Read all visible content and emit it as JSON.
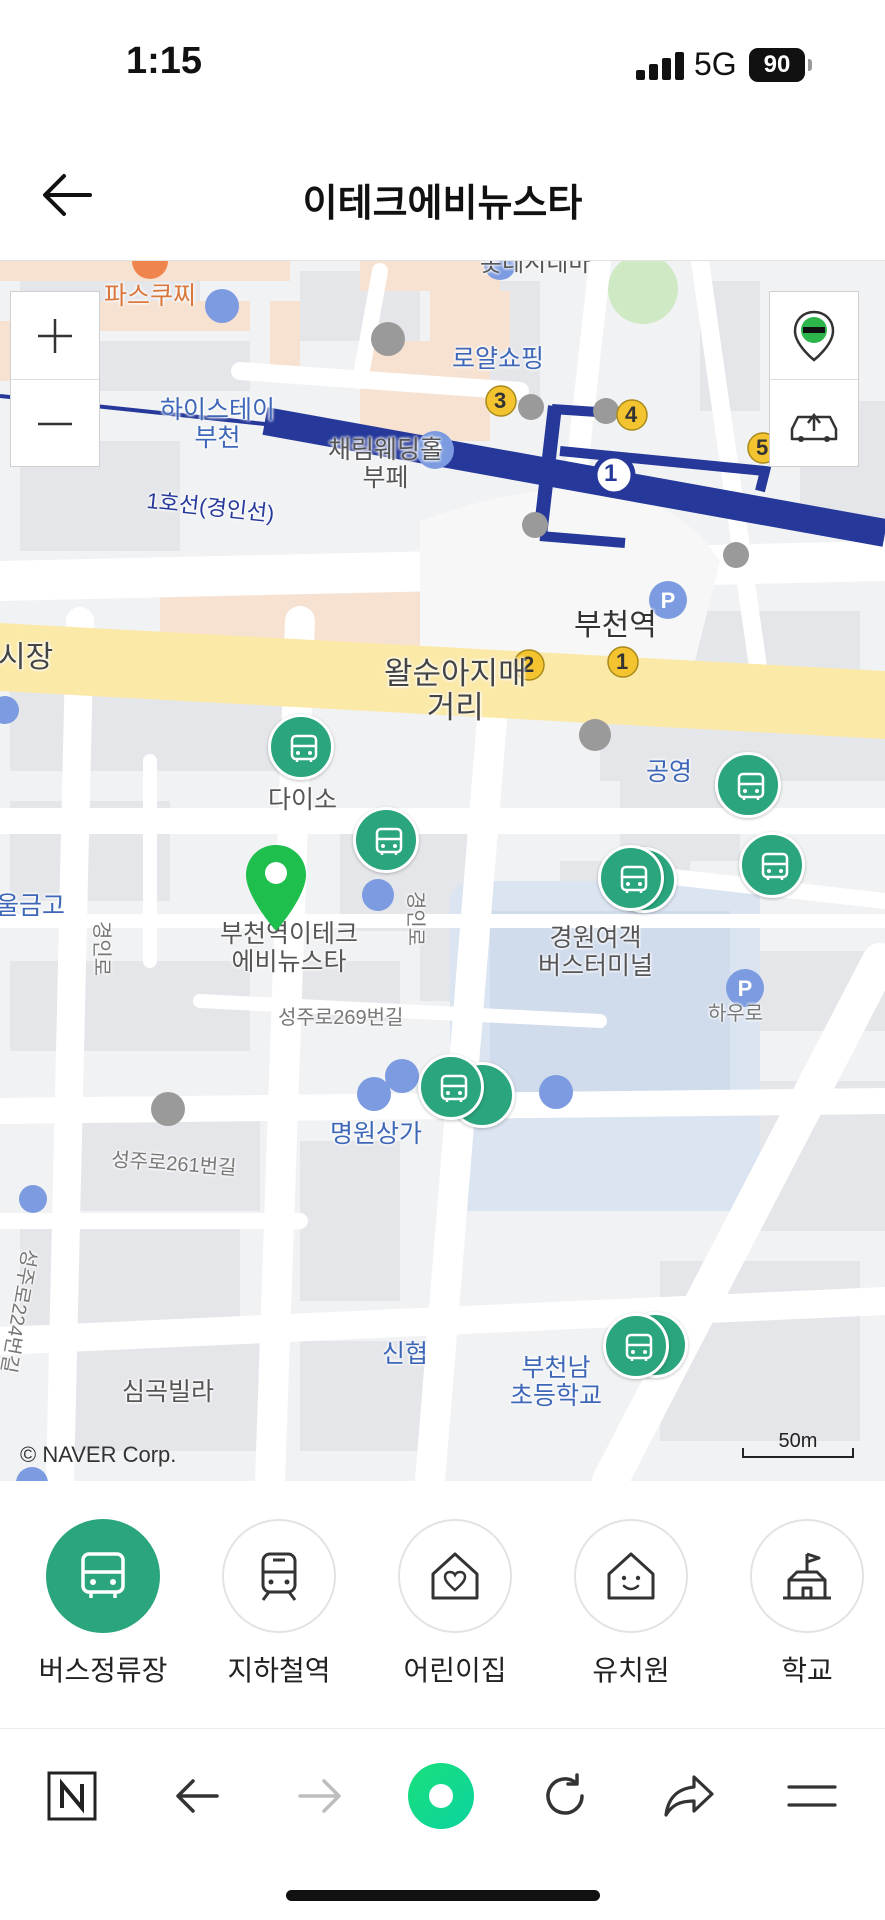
{
  "status_bar": {
    "time": "1:15",
    "network": "5G",
    "battery": "90"
  },
  "header": {
    "title": "이테크에비뉴스타"
  },
  "map": {
    "labels": {
      "pasukuchi": "파스쿠찌",
      "top_partial": "롯데시네마",
      "royal_shopping": "로얄쇼핑",
      "hi_stay_1": "하이스테이",
      "hi_stay_2": "부천",
      "chaerim_1": "채림웨딩홀",
      "chaerim_2": "부페",
      "line1": "1호선(경인선)",
      "bucheon_station": "부천역",
      "market": "시장",
      "walsun_1": "왈순아지매",
      "walsun_2": "거리",
      "daiso": "다이소",
      "public_parking": "공영",
      "geumgo": "울금고",
      "place_name_1": "부천역이테크",
      "place_name_2": "에비뉴스타",
      "gyeongwon_1": "경원여객",
      "gyeongwon_2": "버스터미널",
      "gyeongin_ro_1": "경인로",
      "gyeongin_ro_2": "경인로",
      "seongju_269": "성주로269번길",
      "hau_ro": "하우로",
      "myeongwon": "명원상가",
      "seongju_261": "성주로261번길",
      "road_224": "성주로224번길",
      "sinhyup": "신협",
      "simgok": "심곡빌라",
      "bucheon_nam_1": "부천남",
      "bucheon_nam_2": "초등학교",
      "exit_1": "1",
      "exit_2": "2",
      "exit_3": "3",
      "exit_4": "4",
      "exit_5": "5",
      "line_badge": "1"
    },
    "copyright": "© NAVER Corp.",
    "scale": "50m",
    "zoom_in": "+",
    "zoom_out": "—"
  },
  "categories": [
    {
      "label": "버스정류장",
      "icon": "bus-icon",
      "active": true
    },
    {
      "label": "지하철역",
      "icon": "subway-icon",
      "active": false
    },
    {
      "label": "어린이집",
      "icon": "daycare-icon",
      "active": false
    },
    {
      "label": "유치원",
      "icon": "kindergarten-icon",
      "active": false
    },
    {
      "label": "학교",
      "icon": "school-icon",
      "active": false
    }
  ],
  "colors": {
    "accent": "#2aa57d",
    "subway_line": "#26399a",
    "main_road": "#fbe9a8"
  }
}
